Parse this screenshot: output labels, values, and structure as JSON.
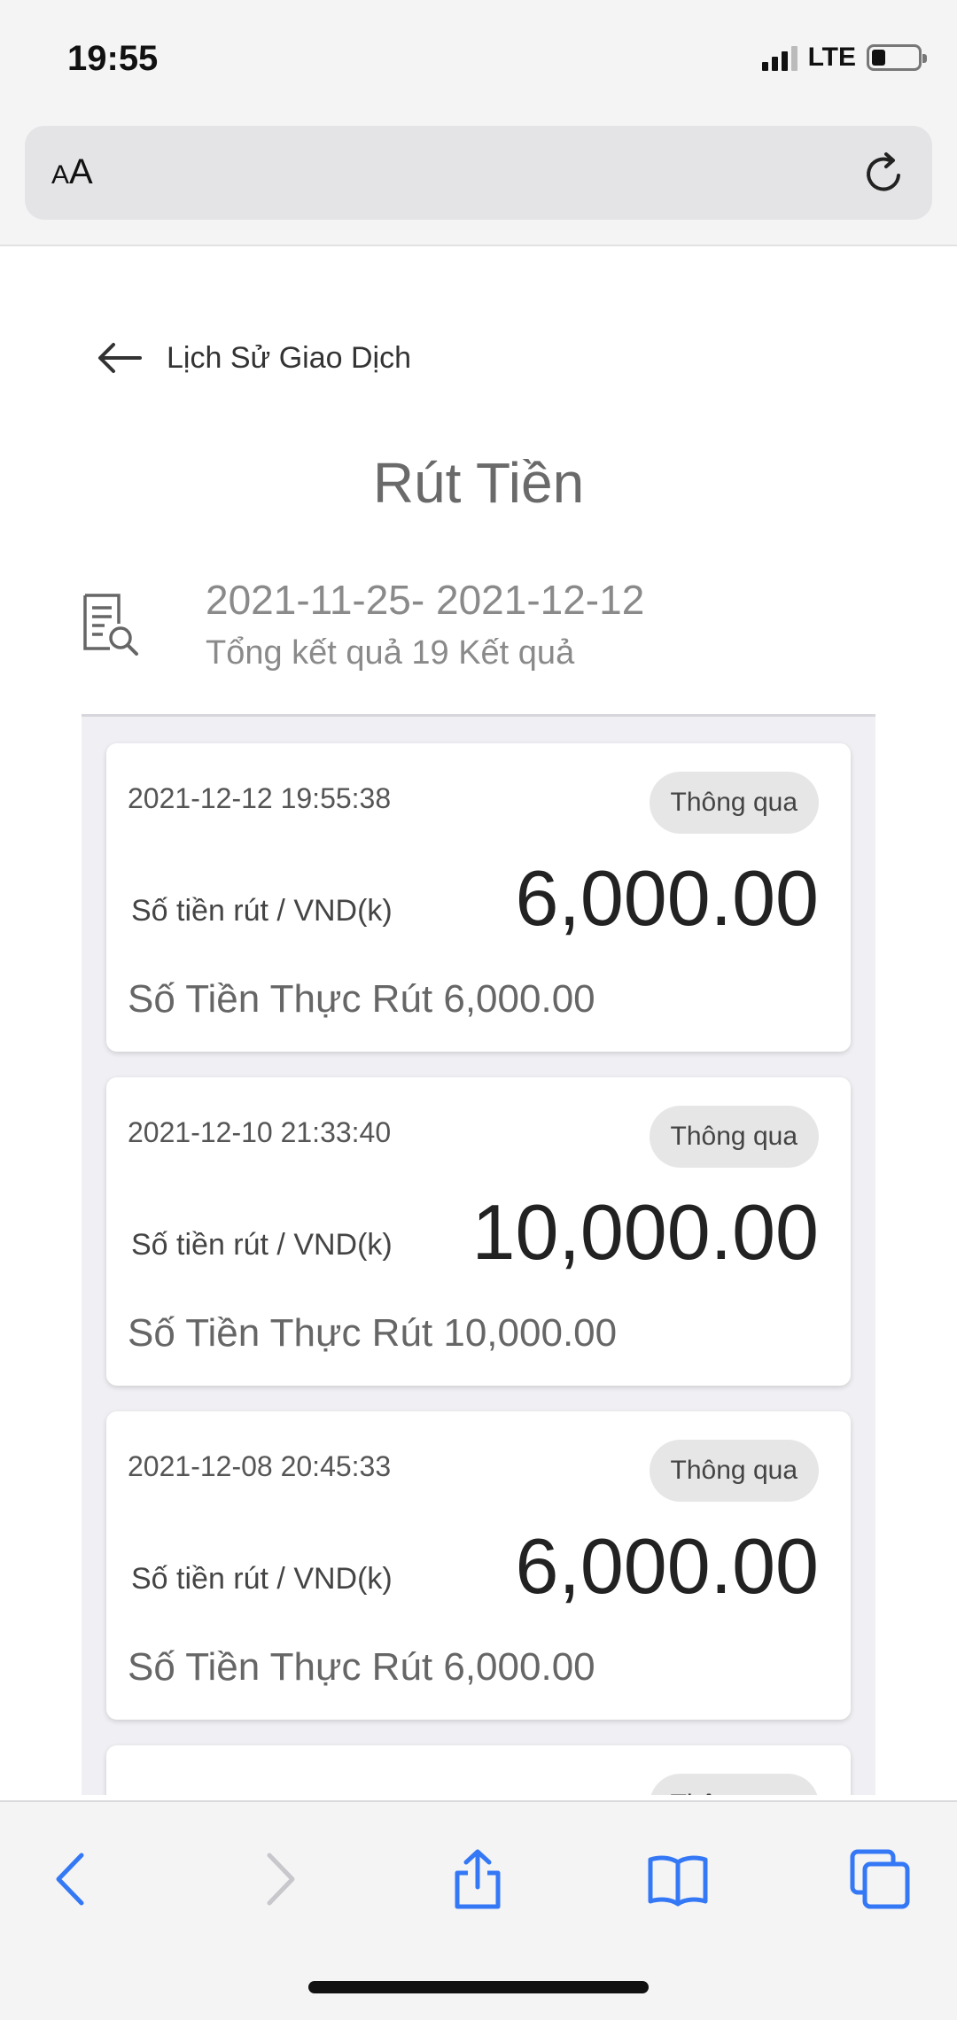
{
  "status_bar": {
    "time": "19:55",
    "network": "LTE",
    "battery_level": 0.3
  },
  "browser": {
    "text_size_label_small": "A",
    "text_size_label_large": "A"
  },
  "header": {
    "back_label": "Lịch Sử Giao Dịch",
    "title": "Rút Tiền"
  },
  "summary": {
    "date_range": "2021-11-25- 2021-12-12",
    "total": "Tổng kết quả 19 Kết quả"
  },
  "transactions": [
    {
      "time": "2021-12-12 19:55:38",
      "status": "Thông qua",
      "amount_label": "Số tiền rút / VND(k)",
      "amount": "6,000.00",
      "actual": "Số Tiền Thực Rút 6,000.00"
    },
    {
      "time": "2021-12-10 21:33:40",
      "status": "Thông qua",
      "amount_label": "Số tiền rút / VND(k)",
      "amount": "10,000.00",
      "actual": "Số Tiền Thực Rút 10,000.00"
    },
    {
      "time": "2021-12-08 20:45:33",
      "status": "Thông qua",
      "amount_label": "Số tiền rút / VND(k)",
      "amount": "6,000.00",
      "actual": "Số Tiền Thực Rút 6,000.00"
    }
  ],
  "partial_card": {
    "status": "Thông qua"
  },
  "colors": {
    "accent": "#3478f6",
    "accent_disabled": "#c7c7cc"
  }
}
